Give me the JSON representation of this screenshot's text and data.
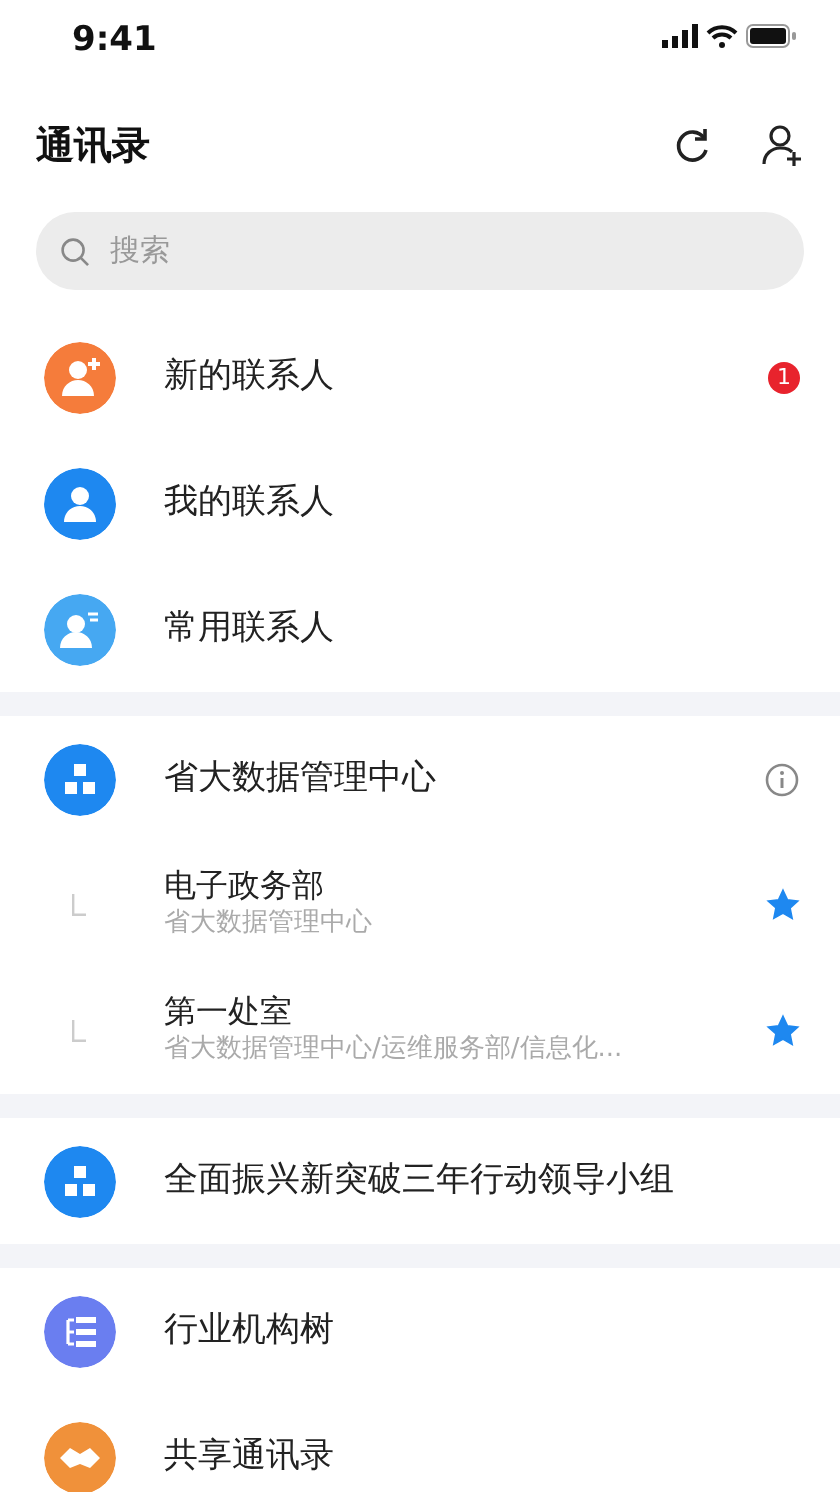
{
  "status_bar": {
    "time": "9:41"
  },
  "header": {
    "title": "通讯录"
  },
  "search": {
    "placeholder": "搜索"
  },
  "sections": [
    {
      "items": [
        {
          "kind": "personplus",
          "color": "#f57c3b",
          "label": "新的联系人",
          "badge": "1"
        },
        {
          "kind": "person",
          "color": "#1e88f0",
          "label": "我的联系人"
        },
        {
          "kind": "personlines",
          "color": "#46a8f2",
          "label": "常用联系人"
        }
      ]
    },
    {
      "items": [
        {
          "kind": "org",
          "color": "#1e88f0",
          "label": "省大数据管理中心",
          "info": true
        },
        {
          "kind": "sub",
          "label": "电子政务部",
          "path": "省大数据管理中心",
          "starred": true
        },
        {
          "kind": "sub",
          "label": "第一处室",
          "path": "省大数据管理中心/运维服务部/信息化...",
          "starred": true
        }
      ]
    },
    {
      "items": [
        {
          "kind": "org",
          "color": "#1e88f0",
          "label": "全面振兴新突破三年行动领导小组"
        }
      ]
    },
    {
      "items": [
        {
          "kind": "tree",
          "color": "#6a7ef0",
          "label": "行业机构树"
        },
        {
          "kind": "handshake",
          "color": "#f0913a",
          "label": "共享通讯录"
        }
      ]
    }
  ]
}
